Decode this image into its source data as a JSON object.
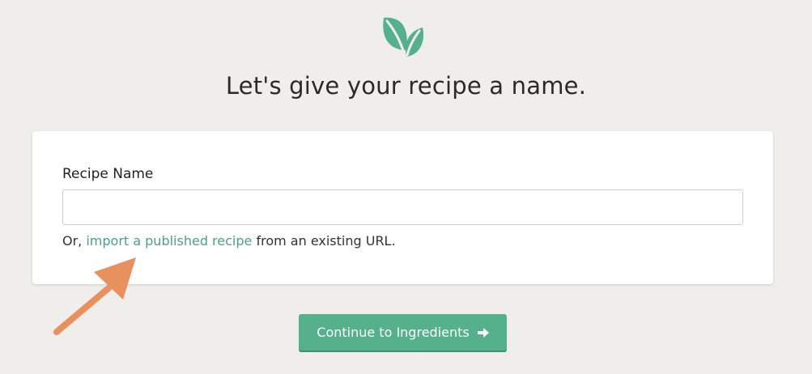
{
  "header": {
    "title": "Let's give your recipe a name."
  },
  "form": {
    "field_label": "Recipe Name",
    "input_value": "",
    "input_placeholder": "",
    "helper_prefix": "Or, ",
    "import_link_text": "import a published recipe",
    "helper_suffix": " from an existing URL."
  },
  "actions": {
    "continue_label": "Continue to Ingredients"
  },
  "icons": {
    "logo": "leaf-logo-icon",
    "continue": "arrow-right-icon",
    "annotation": "annotation-arrow-icon"
  },
  "colors": {
    "background": "#efeeeb",
    "brand_green": "#55b08c",
    "link_green": "#4f9f86",
    "annotation_orange": "#e8915e"
  }
}
